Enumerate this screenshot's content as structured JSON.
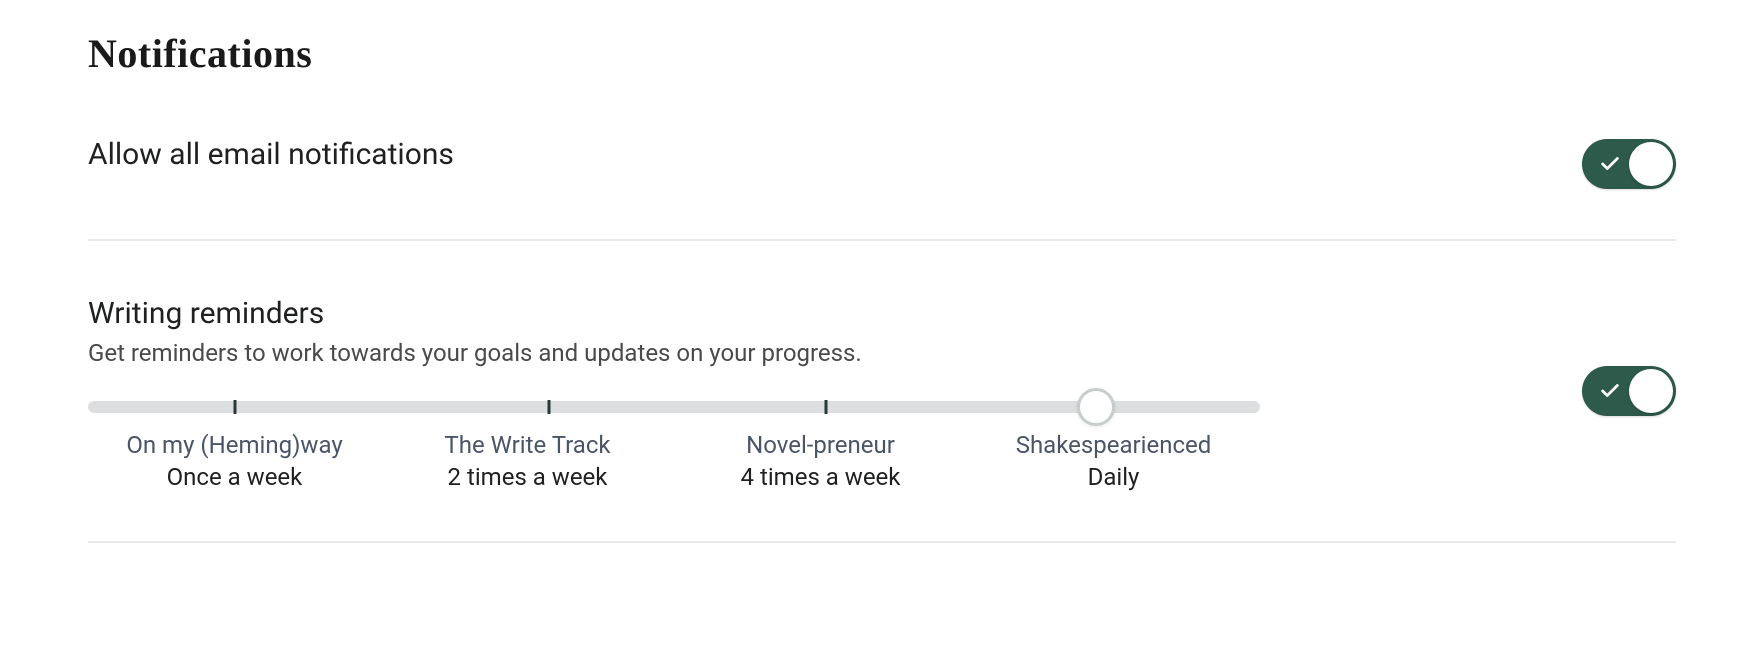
{
  "page_title": "Notifications",
  "sections": {
    "email": {
      "heading": "Allow all email notifications",
      "toggle_on": true
    },
    "reminders": {
      "heading": "Writing reminders",
      "description": "Get reminders to work towards your goals and updates on your progress.",
      "toggle_on": true,
      "slider": {
        "selected_index": 3,
        "options": [
          {
            "title": "On my (Heming)way",
            "sub": "Once a week"
          },
          {
            "title": "The Write Track",
            "sub": "2 times a week"
          },
          {
            "title": "Novel-preneur",
            "sub": "4 times a week"
          },
          {
            "title": "Shakespearienced",
            "sub": "Daily"
          }
        ]
      }
    }
  },
  "colors": {
    "toggle_on_bg": "#2d5a4a"
  }
}
